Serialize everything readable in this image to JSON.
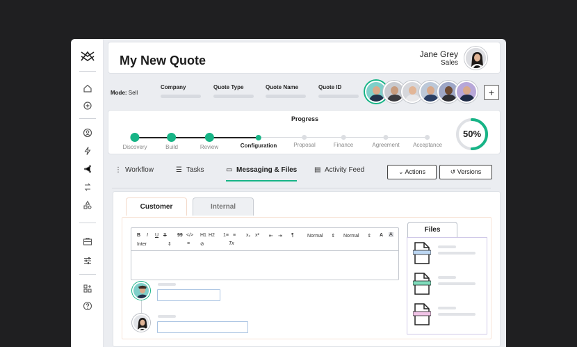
{
  "header": {
    "title": "My New Quote",
    "user_name": "Jane Grey",
    "user_role": "Sales"
  },
  "info": {
    "mode_label": "Mode:",
    "mode_value": "Sell",
    "fields": [
      "Company",
      "Quote Type",
      "Quote Name",
      "Quote ID"
    ],
    "add_label": "+"
  },
  "progress": {
    "title": "Progress",
    "percent_label": "50%",
    "percent": 0.5,
    "steps": [
      {
        "label": "Discovery",
        "state": "done"
      },
      {
        "label": "Build",
        "state": "done"
      },
      {
        "label": "Review",
        "state": "done"
      },
      {
        "label": "Configuration",
        "state": "current"
      },
      {
        "label": "Proposal",
        "state": "todo"
      },
      {
        "label": "Finance",
        "state": "todo"
      },
      {
        "label": "Agreement",
        "state": "todo"
      },
      {
        "label": "Acceptance",
        "state": "todo"
      }
    ]
  },
  "tabs": {
    "workflow": "Workflow",
    "tasks": "Tasks",
    "messaging": "Messaging & Files",
    "activity": "Activity Feed",
    "actions": "Actions",
    "versions": "Versions"
  },
  "composer": {
    "tab_customer": "Customer",
    "tab_internal": "Internal",
    "files_title": "Files",
    "toolbar": {
      "bold": "B",
      "italic": "I",
      "underline": "U",
      "strike": "S",
      "quote": "99",
      "code": "</>",
      "h1": "H1",
      "h2": "H2",
      "ordered": "1≡",
      "bullet": "≡",
      "sub": "x₂",
      "sup": "x²",
      "outdent": "⇤",
      "indent": "⇥",
      "direction": "¶",
      "size_select": "Normal",
      "header_select": "Normal",
      "font_color": "A",
      "background": "A",
      "font_select": "Inter",
      "align": "≡",
      "link": "⊘",
      "clean": "Tx"
    }
  },
  "colors": {
    "accent": "#17b486",
    "background": "#1f1f21",
    "panel": "#ebedf1",
    "file_blue": "#bcd7f3",
    "file_green": "#7fdcbc",
    "file_pink": "#f0c3e6"
  }
}
